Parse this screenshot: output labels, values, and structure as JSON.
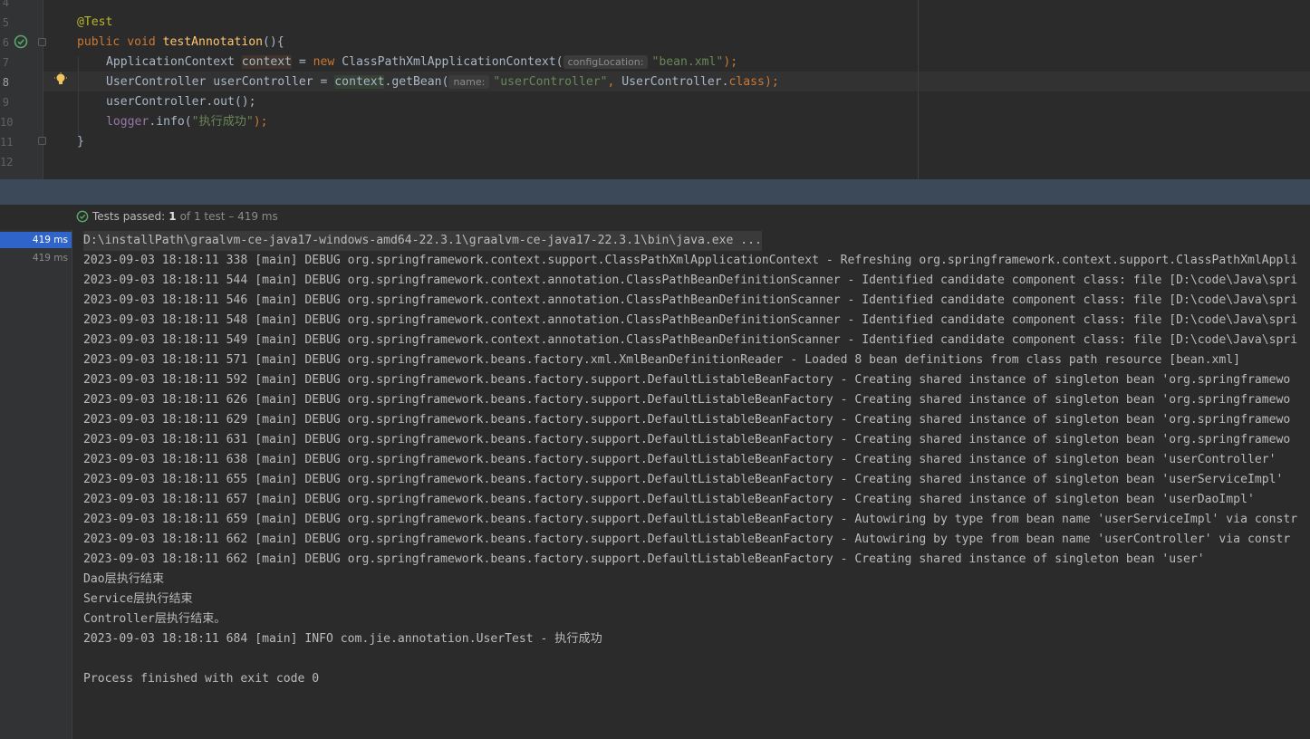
{
  "editor": {
    "line_numbers": [
      "4",
      "5",
      "6",
      "7",
      "8",
      "9",
      "10",
      "11",
      "12"
    ],
    "current_line": "8",
    "code": {
      "annotation": "@Test",
      "kw_public": "public",
      "kw_void": "void",
      "method_name": "testAnnotation",
      "method_open": "(){",
      "ctx_type": "ApplicationContext",
      "ctx_var": "context",
      "eq": " = ",
      "kw_new": "new",
      "ctx_class": "ClassPathXmlApplicationContext(",
      "hint_config": "configLocation:",
      "str_bean_xml": "\"bean.xml\"",
      "close_paren_semi": ");",
      "uc_type": "UserController",
      "uc_var": "userController",
      "ctx_ref": "context",
      "getbean_call": ".getBean(",
      "hint_name": "name:",
      "str_user_controller": "\"userController\"",
      "comma": ",",
      "uc_class_ref": "UserController.",
      "kw_class": "class",
      "out_call": "userController.out();",
      "logger_field": "logger",
      "info_call": ".info(",
      "str_success": "\"执行成功\"",
      "close_brace": "}"
    }
  },
  "run": {
    "status_label": "Tests passed:",
    "passed_count": "1",
    "status_rest": "of 1 test – 419 ms",
    "tree_items": [
      {
        "time": "419 ms",
        "selected": true
      },
      {
        "time": "419 ms",
        "selected": false
      }
    ],
    "console_lines": [
      "D:\\installPath\\graalvm-ce-java17-windows-amd64-22.3.1\\graalvm-ce-java17-22.3.1\\bin\\java.exe ...",
      "2023-09-03 18:18:11 338 [main] DEBUG org.springframework.context.support.ClassPathXmlApplicationContext - Refreshing org.springframework.context.support.ClassPathXmlAppli",
      "2023-09-03 18:18:11 544 [main] DEBUG org.springframework.context.annotation.ClassPathBeanDefinitionScanner - Identified candidate component class: file [D:\\code\\Java\\spri",
      "2023-09-03 18:18:11 546 [main] DEBUG org.springframework.context.annotation.ClassPathBeanDefinitionScanner - Identified candidate component class: file [D:\\code\\Java\\spri",
      "2023-09-03 18:18:11 548 [main] DEBUG org.springframework.context.annotation.ClassPathBeanDefinitionScanner - Identified candidate component class: file [D:\\code\\Java\\spri",
      "2023-09-03 18:18:11 549 [main] DEBUG org.springframework.context.annotation.ClassPathBeanDefinitionScanner - Identified candidate component class: file [D:\\code\\Java\\spri",
      "2023-09-03 18:18:11 571 [main] DEBUG org.springframework.beans.factory.xml.XmlBeanDefinitionReader - Loaded 8 bean definitions from class path resource [bean.xml]",
      "2023-09-03 18:18:11 592 [main] DEBUG org.springframework.beans.factory.support.DefaultListableBeanFactory - Creating shared instance of singleton bean 'org.springframewo",
      "2023-09-03 18:18:11 626 [main] DEBUG org.springframework.beans.factory.support.DefaultListableBeanFactory - Creating shared instance of singleton bean 'org.springframewo",
      "2023-09-03 18:18:11 629 [main] DEBUG org.springframework.beans.factory.support.DefaultListableBeanFactory - Creating shared instance of singleton bean 'org.springframewo",
      "2023-09-03 18:18:11 631 [main] DEBUG org.springframework.beans.factory.support.DefaultListableBeanFactory - Creating shared instance of singleton bean 'org.springframewo",
      "2023-09-03 18:18:11 638 [main] DEBUG org.springframework.beans.factory.support.DefaultListableBeanFactory - Creating shared instance of singleton bean 'userController'",
      "2023-09-03 18:18:11 655 [main] DEBUG org.springframework.beans.factory.support.DefaultListableBeanFactory - Creating shared instance of singleton bean 'userServiceImpl'",
      "2023-09-03 18:18:11 657 [main] DEBUG org.springframework.beans.factory.support.DefaultListableBeanFactory - Creating shared instance of singleton bean 'userDaoImpl'",
      "2023-09-03 18:18:11 659 [main] DEBUG org.springframework.beans.factory.support.DefaultListableBeanFactory - Autowiring by type from bean name 'userServiceImpl' via constr",
      "2023-09-03 18:18:11 662 [main] DEBUG org.springframework.beans.factory.support.DefaultListableBeanFactory - Autowiring by type from bean name 'userController' via constr",
      "2023-09-03 18:18:11 662 [main] DEBUG org.springframework.beans.factory.support.DefaultListableBeanFactory - Creating shared instance of singleton bean 'user'",
      "Dao层执行结束",
      "Service层执行结束",
      "Controller层执行结束。",
      "2023-09-03 18:18:11 684 [main] INFO com.jie.annotation.UserTest - 执行成功",
      "",
      "Process finished with exit code 0"
    ]
  },
  "colors": {
    "passed_green": "#59a869",
    "selection_blue": "#2f65ca",
    "splitbar": "#3c4958",
    "bulb_yellow": "#f2c55c"
  }
}
